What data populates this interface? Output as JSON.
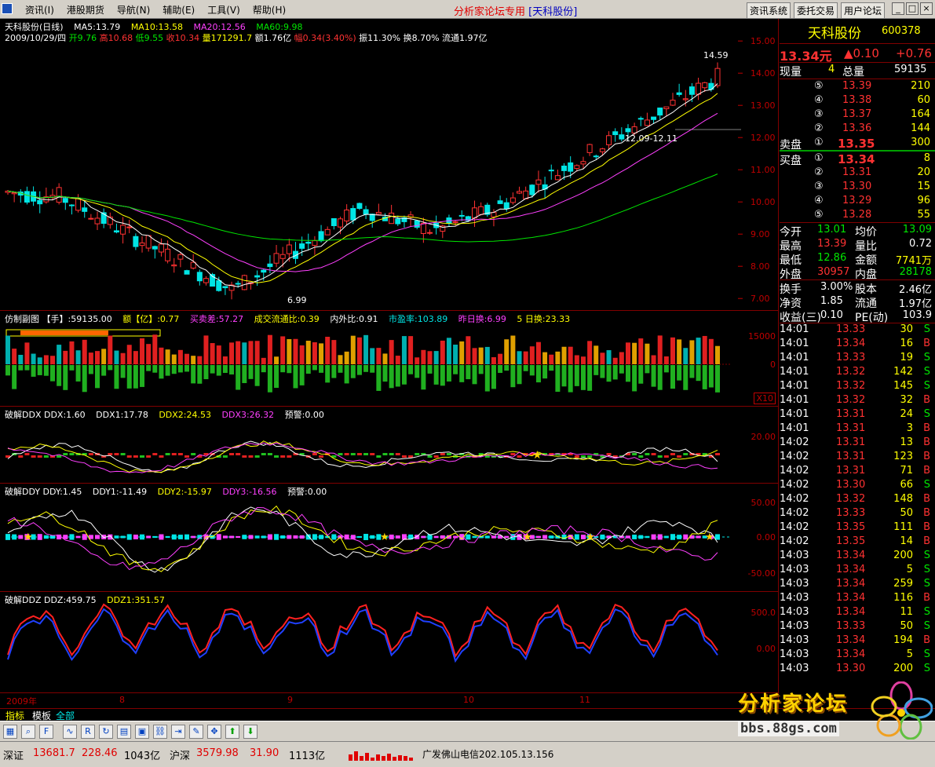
{
  "menubar": {
    "items": [
      "资讯(I)",
      "港股期货",
      "导航(N)",
      "辅助(E)",
      "工具(V)",
      "帮助(H)"
    ],
    "center_title": "分析家论坛专用",
    "center_sub": "[天科股份]",
    "right_buttons": [
      "资讯系统",
      "委托交易",
      "用户论坛"
    ],
    "win_buttons": [
      "_",
      "□",
      "×"
    ]
  },
  "main_panel": {
    "title": "天科股份(日线)",
    "ma5": "MA5:13.79",
    "ma10": "MA10:13.58",
    "ma20": "MA20:12.56",
    "ma60": "MA60:9.98",
    "info_date": "2009/10/29/四",
    "info_open": "开9.76",
    "info_high": "高10.68",
    "info_low": "低9.55",
    "info_close": "收10.34",
    "info_vol": "量171291.7",
    "info_amt": "额1.76亿",
    "info_chg": "幅0.34(3.40%)",
    "info_amp": "振11.30%",
    "info_turn": "换8.70%",
    "info_float": "流通1.97亿",
    "high_label": "14.59",
    "low_label": "6.99",
    "range_label": "12.09-12.11",
    "y_ticks": [
      "15.00",
      "14.00",
      "13.00",
      "12.00",
      "11.00",
      "10.00",
      "9.00",
      "8.00",
      "7.00"
    ]
  },
  "vol_panel": {
    "title": "仿制副图",
    "hand": "【手】:59135.00",
    "amt": "额【亿】:0.77",
    "diff": "买卖差:57.27",
    "ratio": "成交流通比:0.39",
    "inout": "内外比:0.91",
    "pe": "市盈率:103.89",
    "yturn": "昨日换:6.99",
    "turn5": "5 日换:23.33",
    "y_top": "15000",
    "y_zero": "0",
    "scale": "X10"
  },
  "ddx_panel": {
    "title": "破解DDX DDX:1.60",
    "ddx1": "DDX1:17.78",
    "ddx2": "DDX2:24.53",
    "ddx3": "DDX3:26.32",
    "warn": "预警:0.00",
    "y_tick": "20.00"
  },
  "ddy_panel": {
    "title": "破解DDY DDY:1.45",
    "ddy1": "DDY1:-11.49",
    "ddy2": "DDY2:-15.97",
    "ddy3": "DDY3:-16.56",
    "warn": "预警:0.00",
    "y_ticks": [
      "50.00",
      "0.00",
      "-50.00"
    ]
  },
  "ddz_panel": {
    "title": "破解DDZ DDZ:459.75",
    "ddz1": "DDZ1:351.57",
    "y_ticks": [
      "500.0",
      "0.00"
    ]
  },
  "xaxis": {
    "labels": [
      "2009年",
      "8",
      "9",
      "10",
      "11"
    ]
  },
  "tabs": [
    "指标",
    "模板",
    "全部"
  ],
  "quote": {
    "name": "天科股份",
    "code": "600378",
    "price": "13.34元",
    "change": "▲0.10",
    "change2": "+0.76",
    "now_vol_label": "现量",
    "now_vol": "4",
    "total_label": "总量",
    "total": "59135",
    "sell": [
      {
        "lvl": "⑤",
        "price": "13.39",
        "vol": "210"
      },
      {
        "lvl": "④",
        "price": "13.38",
        "vol": "60"
      },
      {
        "lvl": "③",
        "price": "13.37",
        "vol": "164"
      },
      {
        "lvl": "②",
        "price": "13.36",
        "vol": "144"
      },
      {
        "lvl": "①",
        "price": "13.35",
        "vol": "300"
      }
    ],
    "sell_label": "卖盘",
    "buy_label": "买盘",
    "buy": [
      {
        "lvl": "①",
        "price": "13.34",
        "vol": "8"
      },
      {
        "lvl": "②",
        "price": "13.31",
        "vol": "20"
      },
      {
        "lvl": "③",
        "price": "13.30",
        "vol": "15"
      },
      {
        "lvl": "④",
        "price": "13.29",
        "vol": "96"
      },
      {
        "lvl": "⑤",
        "price": "13.28",
        "vol": "55"
      }
    ],
    "stats": [
      {
        "l1": "今开",
        "v1": "13.01",
        "c1": "green",
        "l2": "均价",
        "v2": "13.09",
        "c2": "green"
      },
      {
        "l1": "最高",
        "v1": "13.39",
        "c1": "red",
        "l2": "量比",
        "v2": "0.72",
        "c2": "white"
      },
      {
        "l1": "最低",
        "v1": "12.86",
        "c1": "green",
        "l2": "金额",
        "v2": "7741万",
        "c2": "yellow"
      },
      {
        "l1": "外盘",
        "v1": "30957",
        "c1": "red",
        "l2": "内盘",
        "v2": "28178",
        "c2": "green"
      }
    ],
    "stats2": [
      {
        "l1": "换手",
        "v1": "3.00%",
        "l2": "股本",
        "v2": "2.46亿"
      },
      {
        "l1": "净资",
        "v1": "1.85",
        "l2": "流通",
        "v2": "1.97亿"
      },
      {
        "l1": "收益(三)",
        "v1": "0.10",
        "l2": "PE(动)",
        "v2": "103.9"
      }
    ],
    "ticks": [
      {
        "t": "14:01",
        "p": "13.33",
        "pc": "red",
        "v": "30",
        "s": "S"
      },
      {
        "t": "14:01",
        "p": "13.34",
        "pc": "red",
        "v": "16",
        "s": "B"
      },
      {
        "t": "14:01",
        "p": "13.33",
        "pc": "red",
        "v": "19",
        "s": "S"
      },
      {
        "t": "14:01",
        "p": "13.32",
        "pc": "red",
        "v": "142",
        "s": "S"
      },
      {
        "t": "14:01",
        "p": "13.32",
        "pc": "red",
        "v": "145",
        "s": "S"
      },
      {
        "t": "14:01",
        "p": "13.32",
        "pc": "red",
        "v": "32",
        "s": "B"
      },
      {
        "t": "14:01",
        "p": "13.31",
        "pc": "red",
        "v": "24",
        "s": "S"
      },
      {
        "t": "14:01",
        "p": "13.31",
        "pc": "red",
        "v": "3",
        "s": "B"
      },
      {
        "t": "14:02",
        "p": "13.31",
        "pc": "red",
        "v": "13",
        "s": "B"
      },
      {
        "t": "14:02",
        "p": "13.31",
        "pc": "red",
        "v": "123",
        "s": "B"
      },
      {
        "t": "14:02",
        "p": "13.31",
        "pc": "red",
        "v": "71",
        "s": "B"
      },
      {
        "t": "14:02",
        "p": "13.30",
        "pc": "red",
        "v": "66",
        "s": "S"
      },
      {
        "t": "14:02",
        "p": "13.32",
        "pc": "red",
        "v": "148",
        "s": "B"
      },
      {
        "t": "14:02",
        "p": "13.33",
        "pc": "red",
        "v": "50",
        "s": "B"
      },
      {
        "t": "14:02",
        "p": "13.35",
        "pc": "red",
        "v": "111",
        "s": "B"
      },
      {
        "t": "14:02",
        "p": "13.35",
        "pc": "red",
        "v": "14",
        "s": "B"
      },
      {
        "t": "14:03",
        "p": "13.34",
        "pc": "red",
        "v": "200",
        "s": "S"
      },
      {
        "t": "14:03",
        "p": "13.34",
        "pc": "red",
        "v": "5",
        "s": "S"
      },
      {
        "t": "14:03",
        "p": "13.34",
        "pc": "red",
        "v": "259",
        "s": "S"
      },
      {
        "t": "14:03",
        "p": "13.34",
        "pc": "red",
        "v": "116",
        "s": "B"
      },
      {
        "t": "14:03",
        "p": "13.34",
        "pc": "red",
        "v": "11",
        "s": "S"
      },
      {
        "t": "14:03",
        "p": "13.33",
        "pc": "red",
        "v": "50",
        "s": "S"
      },
      {
        "t": "14:03",
        "p": "13.34",
        "pc": "red",
        "v": "194",
        "s": "B"
      },
      {
        "t": "14:03",
        "p": "13.34",
        "pc": "red",
        "v": "5",
        "s": "S"
      },
      {
        "t": "14:03",
        "p": "13.30",
        "pc": "red",
        "v": "200",
        "s": "S"
      }
    ]
  },
  "statusbar": {
    "sz_label": "深证",
    "sz_val": "13681.7",
    "sz_chg": "228.46",
    "sz_amt": "1043亿",
    "hs_label": "沪深",
    "hs_val": "3579.98",
    "hs_chg": "31.90",
    "hs_amt": "1113亿",
    "server": "广发佛山电信202.105.13.156"
  },
  "watermark": {
    "title": "分析家论坛",
    "url": "bbs.88gs.com"
  },
  "colors": {
    "up": "#ff3232",
    "down": "#00e5e5",
    "ma5": "#ffffff",
    "ma10": "#ffff00",
    "ma20": "#ff40ff",
    "ma60": "#00e600",
    "grid": "#800000"
  }
}
